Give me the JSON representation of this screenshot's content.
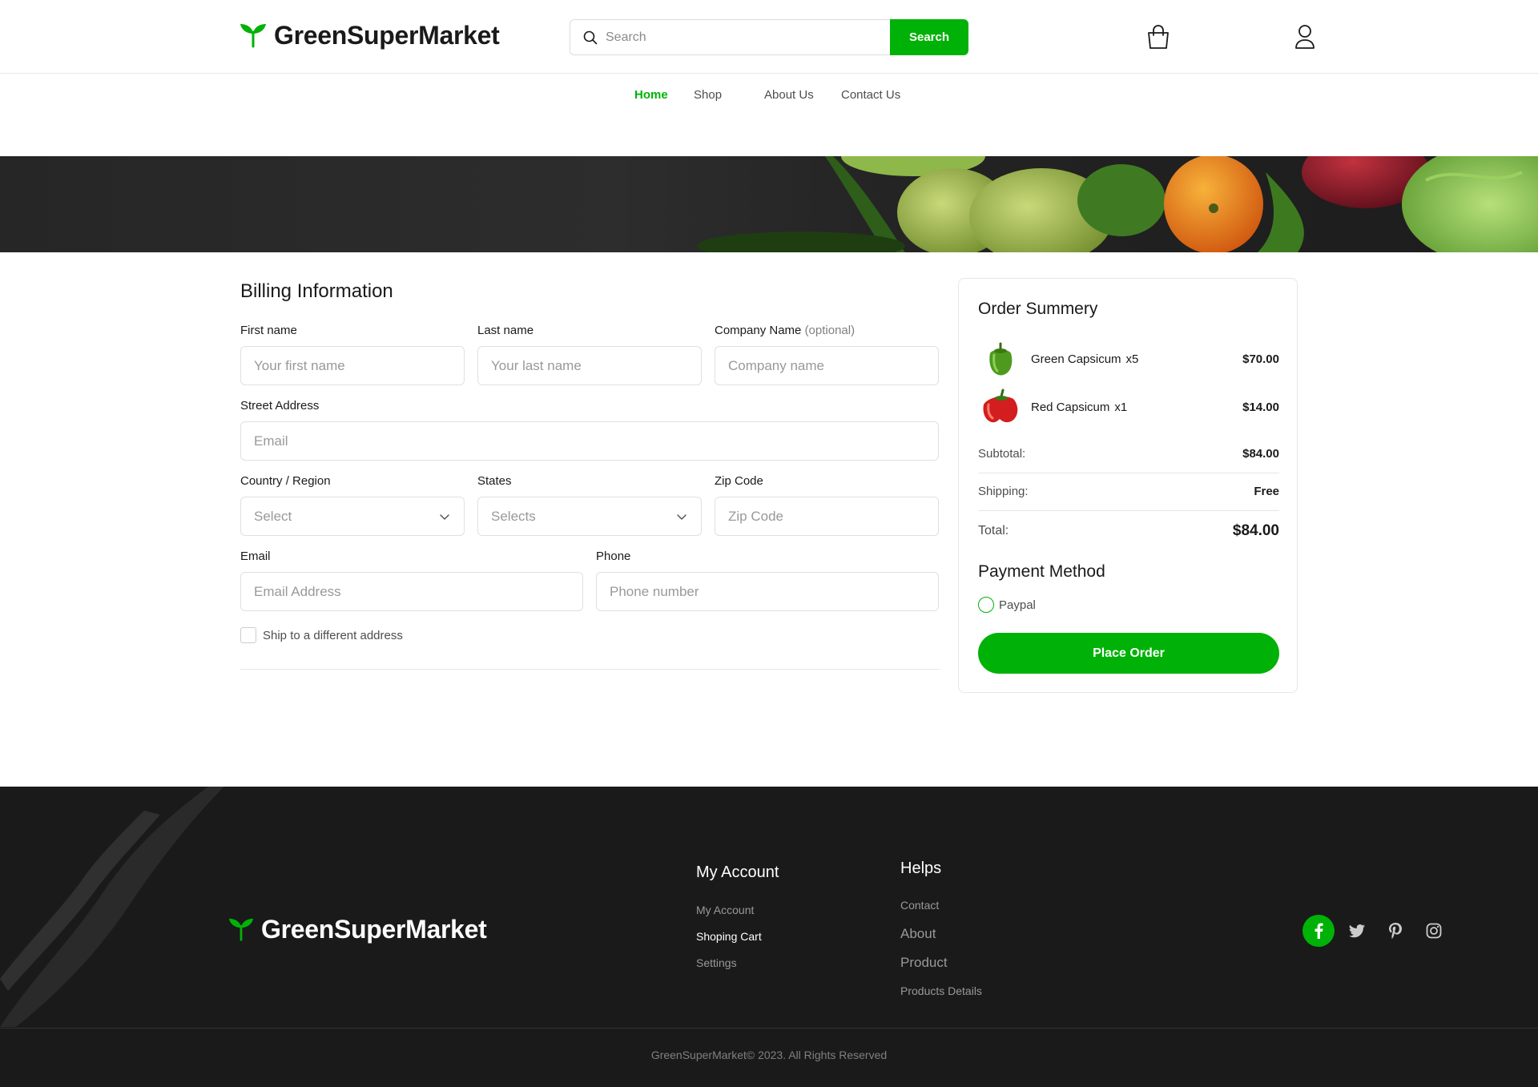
{
  "header": {
    "logo_text": "GreenSuperMarket",
    "search_placeholder": "Search",
    "search_button": "Search",
    "cart_icon": "shopping-bag-icon",
    "user_icon": "user-icon"
  },
  "nav": {
    "items": [
      {
        "label": "Home",
        "active": true
      },
      {
        "label": "Shop",
        "active": false
      },
      {
        "label": "About Us",
        "active": false
      },
      {
        "label": "Contact Us",
        "active": false
      }
    ]
  },
  "billing": {
    "title": "Billing Information",
    "first_name_label": "First name",
    "first_name_placeholder": "Your first name",
    "last_name_label": "Last name",
    "last_name_placeholder": "Your last name",
    "company_label": "Company Name",
    "company_optional": "(optional)",
    "company_placeholder": "Company name",
    "street_label": "Street Address",
    "street_placeholder": "Email",
    "country_label": "Country / Region",
    "country_value": "Select",
    "states_label": "States",
    "states_value": "Selects",
    "zip_label": "Zip Code",
    "zip_placeholder": "Zip Code",
    "email_label": "Email",
    "email_placeholder": "Email Address",
    "phone_label": "Phone",
    "phone_placeholder": "Phone number",
    "ship_different_label": "Ship to a different address",
    "ship_different_checked": false
  },
  "summary": {
    "title": "Order Summery",
    "items": [
      {
        "name": "Green Capsicum",
        "qty": "x5",
        "price": "$70.00",
        "icon": "green-capsicum-icon"
      },
      {
        "name": "Red Capsicum",
        "qty": "x1",
        "price": "$14.00",
        "icon": "red-capsicum-icon"
      }
    ],
    "subtotal_label": "Subtotal:",
    "subtotal_value": "$84.00",
    "shipping_label": "Shipping:",
    "shipping_value": "Free",
    "total_label": "Total:",
    "total_value": "$84.00",
    "payment_title": "Payment Method",
    "payment_option": "Paypal",
    "place_order": "Place Order"
  },
  "footer": {
    "logo_text": "GreenSuperMarket",
    "account_title": "My Account",
    "account_links": [
      "My Account",
      "Shoping Cart",
      "Settings"
    ],
    "helps_title": "Helps",
    "helps_links": [
      "Contact",
      "About",
      "Product",
      "Products Details"
    ],
    "socials": [
      "facebook-icon",
      "twitter-icon",
      "pinterest-icon",
      "instagram-icon"
    ],
    "copyright": "GreenSuperMarket© 2023. All Rights Reserved"
  },
  "colors": {
    "accent": "#00b207",
    "footer_bg": "#1a1a1a"
  }
}
